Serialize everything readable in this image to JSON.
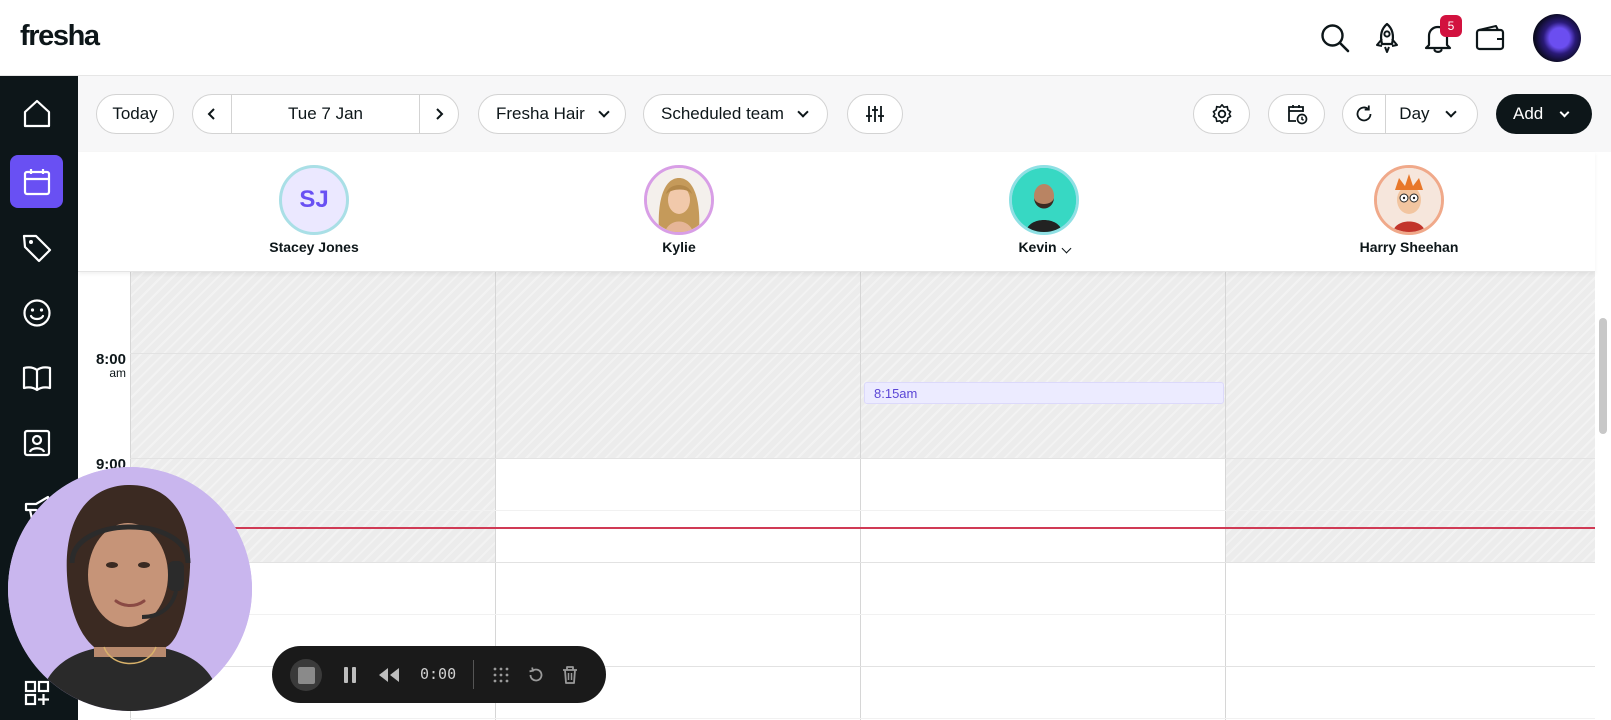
{
  "app": {
    "logo": "fresha"
  },
  "topbar": {
    "icons": [
      "search-icon",
      "rocket-icon",
      "bell-icon",
      "wallet-icon"
    ],
    "notification_count": "5"
  },
  "sidebar": {
    "items": [
      {
        "name": "home-icon",
        "active": false
      },
      {
        "name": "calendar-icon",
        "active": true
      },
      {
        "name": "sales-tag-icon",
        "active": false
      },
      {
        "name": "clients-smile-icon",
        "active": false
      },
      {
        "name": "catalog-book-icon",
        "active": false
      },
      {
        "name": "team-contact-icon",
        "active": false
      },
      {
        "name": "marketing-megaphone-icon",
        "active": false
      },
      {
        "name": "apps-grid-icon",
        "active": false
      }
    ]
  },
  "toolbar": {
    "today_label": "Today",
    "date_label": "Tue 7 Jan",
    "location_label": "Fresha Hair",
    "team_label": "Scheduled team",
    "view_label": "Day",
    "add_label": "Add"
  },
  "staff": [
    {
      "name": "Stacey Jones",
      "initials": "SJ",
      "ring_color": "#a9dfe6"
    },
    {
      "name": "Kylie",
      "initials": "",
      "ring_color": "#d89ee6"
    },
    {
      "name": "Kevin",
      "initials": "",
      "ring_color": "#8fe0e4"
    },
    {
      "name": "Harry Sheehan",
      "initials": "",
      "ring_color": "#f0a98a"
    }
  ],
  "calendar": {
    "times": [
      {
        "hour": "8:00",
        "ampm": "am"
      },
      {
        "hour": "9:00",
        "ampm": ""
      }
    ],
    "appointment": {
      "time": "8:15am"
    }
  },
  "recorder": {
    "timer": "0:00"
  },
  "colors": {
    "accent": "#6950f3",
    "sidebar": "#0d1619",
    "now_line": "#d03a55",
    "badge": "#d2123f"
  }
}
